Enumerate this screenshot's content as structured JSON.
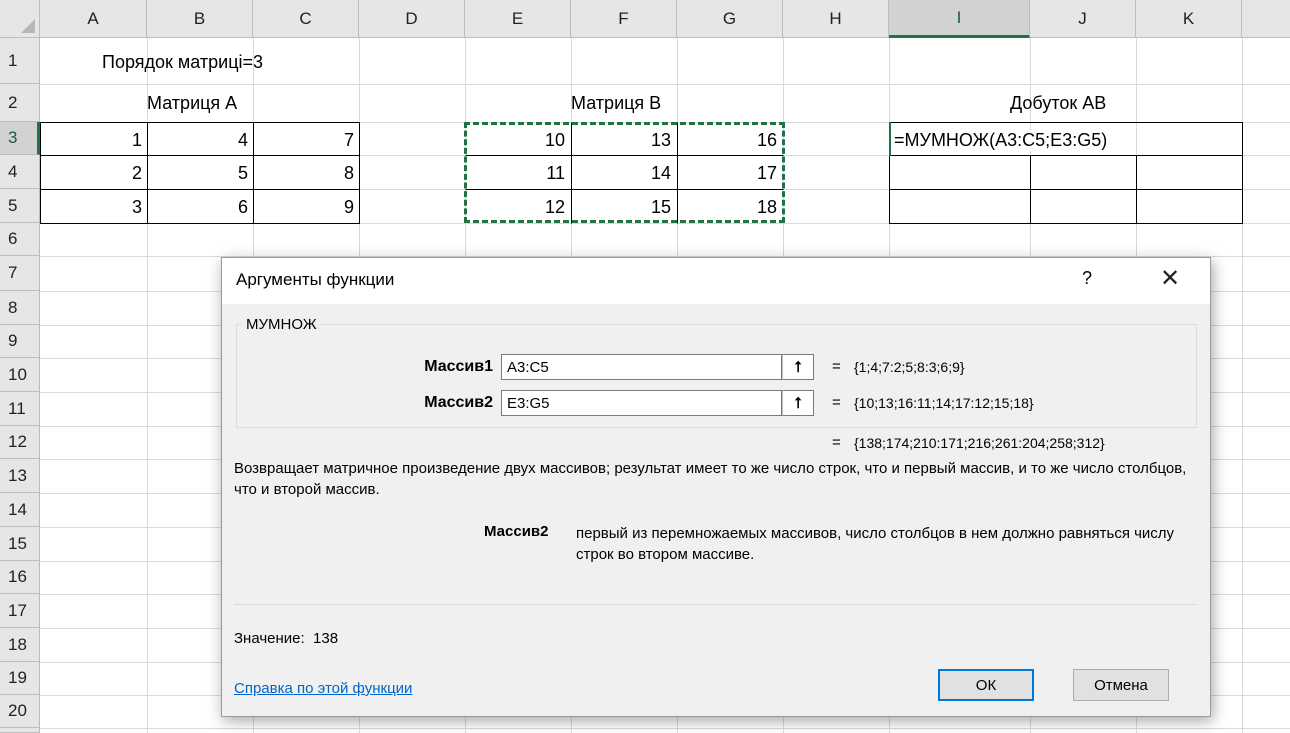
{
  "sheet": {
    "columns": [
      "A",
      "B",
      "C",
      "D",
      "E",
      "F",
      "G",
      "H",
      "I",
      "J",
      "K"
    ],
    "rows": [
      "1",
      "2",
      "3",
      "4",
      "5",
      "6",
      "7",
      "8",
      "9",
      "10",
      "11",
      "12",
      "13",
      "14",
      "15",
      "16",
      "17",
      "18",
      "19",
      "20"
    ],
    "order_label": "Порядок матриці=3",
    "matrix_a_title": "Матриця А",
    "matrix_b_title": "Матриця В",
    "product_title": "Добуток АВ",
    "matrix_a": [
      [
        "1",
        "4",
        "7"
      ],
      [
        "2",
        "5",
        "8"
      ],
      [
        "3",
        "6",
        "9"
      ]
    ],
    "matrix_b": [
      [
        "10",
        "13",
        "16"
      ],
      [
        "11",
        "14",
        "17"
      ],
      [
        "12",
        "15",
        "18"
      ]
    ],
    "formula": "=МУМНОЖ(A3:C5;E3:G5)"
  },
  "dialog": {
    "title": "Аргументы функции",
    "help_glyph": "?",
    "close_glyph": "✕",
    "function_name": "МУМНОЖ",
    "arg1": {
      "label": "Массив1",
      "value": "A3:C5",
      "result": "{1;4;7:2;5;8:3;6;9}"
    },
    "arg2": {
      "label": "Массив2",
      "value": "E3:G5",
      "result": "{10;13;16:11;14;17:12;15;18}"
    },
    "eq": "=",
    "overall_result": "{138;174;210:171;216;261:204;258;312}",
    "description": "Возвращает матричное произведение двух массивов; результат имеет то же число строк, что и первый массив, и то же число столбцов, что и второй массив.",
    "arg_desc_label": "Массив2",
    "arg_desc": "первый из перемножаемых массивов, число столбцов в нем должно равняться числу строк во втором массиве.",
    "value_label": "Значение:",
    "value": "138",
    "help_link": "Справка по этой функции",
    "ok": "ОК",
    "cancel": "Отмена",
    "ref_icon": "collapse-dialog-icon"
  }
}
